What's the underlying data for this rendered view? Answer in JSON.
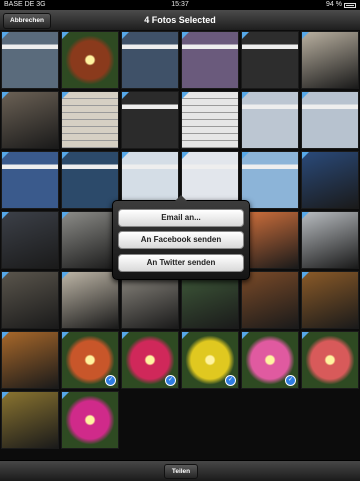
{
  "status_bar": {
    "carrier": "BASE DE  3G",
    "time": "15:37",
    "battery": "94 %"
  },
  "nav": {
    "title": "4 Fotos Selected",
    "cancel_label": "Abbrechen"
  },
  "share_menu": {
    "email_label": "Email an...",
    "facebook_label": "An Facebook senden",
    "twitter_label": "An Twitter senden"
  },
  "toolbar": {
    "share_label": "Teilen"
  },
  "photos": [
    {
      "kind": "screenshot",
      "color": "#5a6b7c",
      "selected": false
    },
    {
      "kind": "flower",
      "color": "#8a3a1c",
      "selected": false
    },
    {
      "kind": "screenshot",
      "color": "#3f5168",
      "selected": false
    },
    {
      "kind": "screenshot",
      "color": "#6a5a7c",
      "selected": false
    },
    {
      "kind": "screenshot",
      "color": "#2d2d2d",
      "selected": false
    },
    {
      "kind": "photo",
      "color": "#b9b0a0",
      "selected": false
    },
    {
      "kind": "photo",
      "color": "#6b6155",
      "selected": false
    },
    {
      "kind": "document",
      "color": "#d6d0c4",
      "selected": false
    },
    {
      "kind": "screenshot",
      "color": "#2b2b2b",
      "selected": false
    },
    {
      "kind": "document",
      "color": "#e6e6e6",
      "selected": false
    },
    {
      "kind": "screenshot",
      "color": "#bcc6d2",
      "selected": false
    },
    {
      "kind": "screenshot",
      "color": "#b7c2cf",
      "selected": false
    },
    {
      "kind": "screenshot",
      "color": "#3a5a8c",
      "selected": false
    },
    {
      "kind": "screenshot",
      "color": "#2c4a6a",
      "selected": false
    },
    {
      "kind": "screenshot",
      "color": "#d4dde6",
      "selected": false
    },
    {
      "kind": "screenshot",
      "color": "#e2e6ec",
      "selected": false
    },
    {
      "kind": "screenshot",
      "color": "#8cb4d8",
      "selected": false
    },
    {
      "kind": "photo",
      "color": "#2a4a7a",
      "selected": false
    },
    {
      "kind": "photo",
      "color": "#3c4048",
      "selected": false
    },
    {
      "kind": "photo",
      "color": "#8c8c88",
      "selected": false
    },
    {
      "kind": "photo",
      "color": "#2a2a2a",
      "selected": false
    },
    {
      "kind": "photo",
      "color": "#4a4a48",
      "selected": false
    },
    {
      "kind": "photo",
      "color": "#d0703c",
      "selected": false
    },
    {
      "kind": "photo",
      "color": "#b8bcc0",
      "selected": false
    },
    {
      "kind": "photo",
      "color": "#5a554c",
      "selected": false
    },
    {
      "kind": "photo",
      "color": "#bdb5a6",
      "selected": false
    },
    {
      "kind": "photo",
      "color": "#8c8880",
      "selected": false
    },
    {
      "kind": "photo",
      "color": "#3f5a3a",
      "selected": false
    },
    {
      "kind": "photo",
      "color": "#7a4a28",
      "selected": false
    },
    {
      "kind": "photo",
      "color": "#8a5a28",
      "selected": false
    },
    {
      "kind": "photo",
      "color": "#a8682a",
      "selected": false
    },
    {
      "kind": "flower",
      "color": "#c8562a",
      "selected": true
    },
    {
      "kind": "flower",
      "color": "#d0285a",
      "selected": true
    },
    {
      "kind": "flower",
      "color": "#e0c820",
      "selected": true
    },
    {
      "kind": "flower",
      "color": "#e05aa0",
      "selected": true
    },
    {
      "kind": "flower",
      "color": "#d85a5a",
      "selected": false
    },
    {
      "kind": "photo",
      "color": "#8a7430",
      "selected": false
    },
    {
      "kind": "flower",
      "color": "#d02a8a",
      "selected": false
    }
  ]
}
